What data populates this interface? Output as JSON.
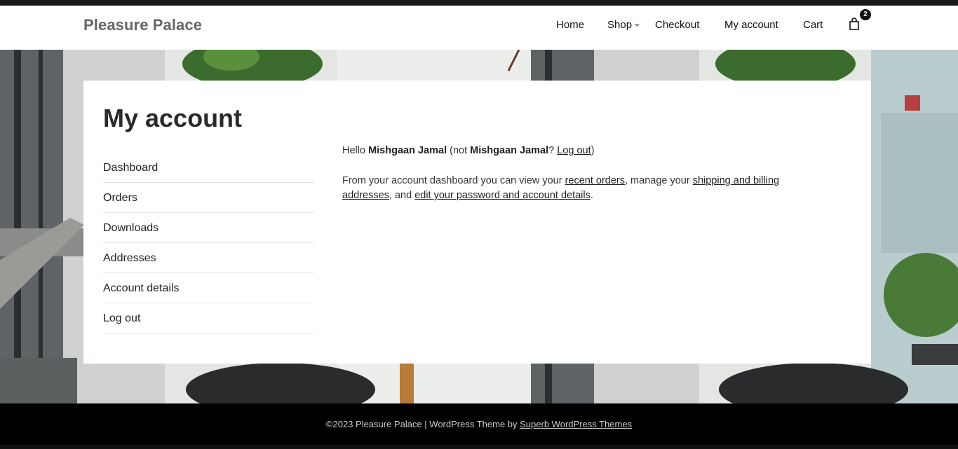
{
  "site": {
    "title": "Pleasure Palace"
  },
  "nav": {
    "home": "Home",
    "shop": "Shop",
    "checkout": "Checkout",
    "my_account": "My account",
    "cart": "Cart",
    "cart_count": "2"
  },
  "account": {
    "title": "My account",
    "menu": [
      "Dashboard",
      "Orders",
      "Downloads",
      "Addresses",
      "Account details",
      "Log out"
    ],
    "greeting_hello": "Hello ",
    "user_name": "Mishgaan Jamal",
    "greeting_not": " (not ",
    "greeting_q": "? ",
    "logout_link": "Log out",
    "greeting_close": ")",
    "dash_intro": "From your account dashboard you can view your ",
    "recent_orders_link": "recent orders",
    "dash_mid": ", manage your ",
    "addresses_link": "shipping and billing addresses",
    "dash_and": ", and ",
    "password_link": "edit your password and account details",
    "dash_end": "."
  },
  "footer": {
    "text": "©2023 Pleasure Palace | WordPress Theme by ",
    "link": "Superb WordPress Themes"
  },
  "colors": {
    "accent": "#111111",
    "footer_bg": "#000000",
    "card_bg": "#ffffff"
  }
}
